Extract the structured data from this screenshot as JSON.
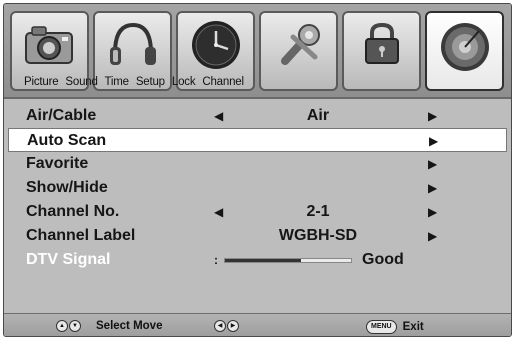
{
  "tabs": [
    {
      "label": "Picture",
      "icon": "camera-icon"
    },
    {
      "label": "Sound",
      "icon": "headphones-icon"
    },
    {
      "label": "Time",
      "icon": "clock-icon"
    },
    {
      "label": "Setup",
      "icon": "wrench-icon"
    },
    {
      "label": "Lock",
      "icon": "padlock-icon"
    },
    {
      "label": "Channel",
      "icon": "satellite-dish-icon",
      "active": true
    }
  ],
  "menu": {
    "air_cable": {
      "label": "Air/Cable",
      "value": "Air"
    },
    "auto_scan": {
      "label": "Auto Scan"
    },
    "favorite": {
      "label": "Favorite"
    },
    "show_hide": {
      "label": "Show/Hide"
    },
    "channel_no": {
      "label": "Channel No.",
      "value": "2-1"
    },
    "channel_label": {
      "label": "Channel Label",
      "value": "WGBH-SD"
    },
    "dtv_signal": {
      "label": "DTV Signal",
      "quality": "Good",
      "strength_fraction": 0.6
    }
  },
  "arrows": {
    "left": "◀",
    "right": "▶",
    "dot": ":"
  },
  "footer": {
    "select_move": "Select Move",
    "exit": "Exit",
    "menu_key": "MENU",
    "updown_key": "▲▼",
    "leftright_key": "◀▶"
  },
  "colors": {
    "selected_row": "#ffffff",
    "disabled_text": "#ffffff"
  }
}
